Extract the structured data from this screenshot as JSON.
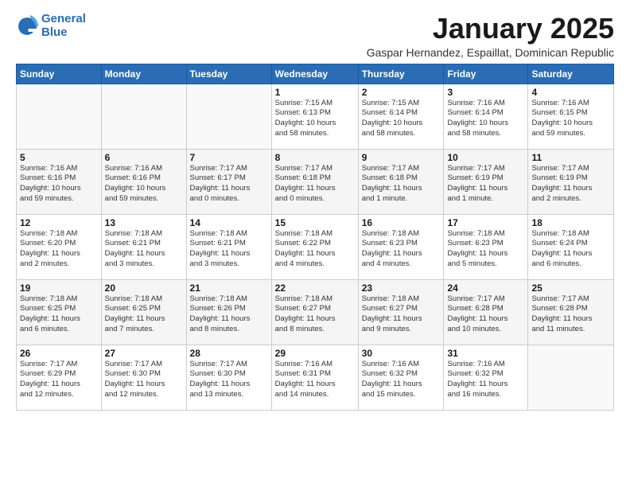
{
  "logo": {
    "line1": "General",
    "line2": "Blue"
  },
  "title": "January 2025",
  "subtitle": "Gaspar Hernandez, Espaillat, Dominican Republic",
  "weekdays": [
    "Sunday",
    "Monday",
    "Tuesday",
    "Wednesday",
    "Thursday",
    "Friday",
    "Saturday"
  ],
  "weeks": [
    [
      {
        "day": "",
        "info": ""
      },
      {
        "day": "",
        "info": ""
      },
      {
        "day": "",
        "info": ""
      },
      {
        "day": "1",
        "info": "Sunrise: 7:15 AM\nSunset: 6:13 PM\nDaylight: 10 hours\nand 58 minutes."
      },
      {
        "day": "2",
        "info": "Sunrise: 7:15 AM\nSunset: 6:14 PM\nDaylight: 10 hours\nand 58 minutes."
      },
      {
        "day": "3",
        "info": "Sunrise: 7:16 AM\nSunset: 6:14 PM\nDaylight: 10 hours\nand 58 minutes."
      },
      {
        "day": "4",
        "info": "Sunrise: 7:16 AM\nSunset: 6:15 PM\nDaylight: 10 hours\nand 59 minutes."
      }
    ],
    [
      {
        "day": "5",
        "info": "Sunrise: 7:16 AM\nSunset: 6:16 PM\nDaylight: 10 hours\nand 59 minutes."
      },
      {
        "day": "6",
        "info": "Sunrise: 7:16 AM\nSunset: 6:16 PM\nDaylight: 10 hours\nand 59 minutes."
      },
      {
        "day": "7",
        "info": "Sunrise: 7:17 AM\nSunset: 6:17 PM\nDaylight: 11 hours\nand 0 minutes."
      },
      {
        "day": "8",
        "info": "Sunrise: 7:17 AM\nSunset: 6:18 PM\nDaylight: 11 hours\nand 0 minutes."
      },
      {
        "day": "9",
        "info": "Sunrise: 7:17 AM\nSunset: 6:18 PM\nDaylight: 11 hours\nand 1 minute."
      },
      {
        "day": "10",
        "info": "Sunrise: 7:17 AM\nSunset: 6:19 PM\nDaylight: 11 hours\nand 1 minute."
      },
      {
        "day": "11",
        "info": "Sunrise: 7:17 AM\nSunset: 6:19 PM\nDaylight: 11 hours\nand 2 minutes."
      }
    ],
    [
      {
        "day": "12",
        "info": "Sunrise: 7:18 AM\nSunset: 6:20 PM\nDaylight: 11 hours\nand 2 minutes."
      },
      {
        "day": "13",
        "info": "Sunrise: 7:18 AM\nSunset: 6:21 PM\nDaylight: 11 hours\nand 3 minutes."
      },
      {
        "day": "14",
        "info": "Sunrise: 7:18 AM\nSunset: 6:21 PM\nDaylight: 11 hours\nand 3 minutes."
      },
      {
        "day": "15",
        "info": "Sunrise: 7:18 AM\nSunset: 6:22 PM\nDaylight: 11 hours\nand 4 minutes."
      },
      {
        "day": "16",
        "info": "Sunrise: 7:18 AM\nSunset: 6:23 PM\nDaylight: 11 hours\nand 4 minutes."
      },
      {
        "day": "17",
        "info": "Sunrise: 7:18 AM\nSunset: 6:23 PM\nDaylight: 11 hours\nand 5 minutes."
      },
      {
        "day": "18",
        "info": "Sunrise: 7:18 AM\nSunset: 6:24 PM\nDaylight: 11 hours\nand 6 minutes."
      }
    ],
    [
      {
        "day": "19",
        "info": "Sunrise: 7:18 AM\nSunset: 6:25 PM\nDaylight: 11 hours\nand 6 minutes."
      },
      {
        "day": "20",
        "info": "Sunrise: 7:18 AM\nSunset: 6:25 PM\nDaylight: 11 hours\nand 7 minutes."
      },
      {
        "day": "21",
        "info": "Sunrise: 7:18 AM\nSunset: 6:26 PM\nDaylight: 11 hours\nand 8 minutes."
      },
      {
        "day": "22",
        "info": "Sunrise: 7:18 AM\nSunset: 6:27 PM\nDaylight: 11 hours\nand 8 minutes."
      },
      {
        "day": "23",
        "info": "Sunrise: 7:18 AM\nSunset: 6:27 PM\nDaylight: 11 hours\nand 9 minutes."
      },
      {
        "day": "24",
        "info": "Sunrise: 7:17 AM\nSunset: 6:28 PM\nDaylight: 11 hours\nand 10 minutes."
      },
      {
        "day": "25",
        "info": "Sunrise: 7:17 AM\nSunset: 6:28 PM\nDaylight: 11 hours\nand 11 minutes."
      }
    ],
    [
      {
        "day": "26",
        "info": "Sunrise: 7:17 AM\nSunset: 6:29 PM\nDaylight: 11 hours\nand 12 minutes."
      },
      {
        "day": "27",
        "info": "Sunrise: 7:17 AM\nSunset: 6:30 PM\nDaylight: 11 hours\nand 12 minutes."
      },
      {
        "day": "28",
        "info": "Sunrise: 7:17 AM\nSunset: 6:30 PM\nDaylight: 11 hours\nand 13 minutes."
      },
      {
        "day": "29",
        "info": "Sunrise: 7:16 AM\nSunset: 6:31 PM\nDaylight: 11 hours\nand 14 minutes."
      },
      {
        "day": "30",
        "info": "Sunrise: 7:16 AM\nSunset: 6:32 PM\nDaylight: 11 hours\nand 15 minutes."
      },
      {
        "day": "31",
        "info": "Sunrise: 7:16 AM\nSunset: 6:32 PM\nDaylight: 11 hours\nand 16 minutes."
      },
      {
        "day": "",
        "info": ""
      }
    ]
  ]
}
